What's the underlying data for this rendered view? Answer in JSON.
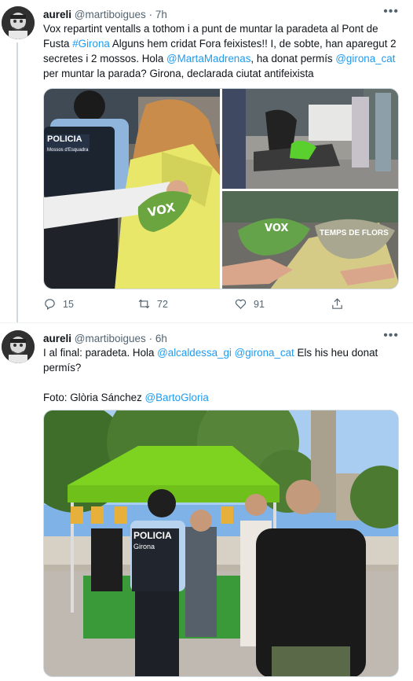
{
  "tweets": [
    {
      "name": "aureli",
      "handle": "@martiboigues",
      "time": "7h",
      "text_parts": [
        {
          "t": "Vox repartint ventalls a tothom i a punt de muntar la paradeta al Pont de Fusta ",
          "link": false
        },
        {
          "t": "#Girona",
          "link": true
        },
        {
          "t": " Alguns hem cridat Fora feixistes!! I, de sobte, han aparegut 2 secretes i 2 mossos. Hola ",
          "link": false
        },
        {
          "t": "@MartaMadrenas",
          "link": true
        },
        {
          "t": ", ha donat permís ",
          "link": false
        },
        {
          "t": "@girona_cat",
          "link": true
        },
        {
          "t": " per muntar la parada? Girona, declarada ciutat antifeixista",
          "link": false
        }
      ],
      "media_labels": {
        "police_patch": "POLICIA",
        "police_sub": "Mossos d'Esquadra",
        "fan_logo": "VOX",
        "fan_logo_2": "VOX",
        "fan_text": "TEMPS DE FLORS"
      },
      "reply_count": "15",
      "retweet_count": "72",
      "like_count": "91"
    },
    {
      "name": "aureli",
      "handle": "@martiboigues",
      "time": "6h",
      "text_parts": [
        {
          "t": "I al final: paradeta. Hola ",
          "link": false
        },
        {
          "t": "@alcaldessa_gi",
          "link": true
        },
        {
          "t": " ",
          "link": false
        },
        {
          "t": "@girona_cat",
          "link": true
        },
        {
          "t": " Els his heu donat permís?",
          "link": false
        },
        {
          "t": "\n\nFoto:  Glòria Sánchez ",
          "link": false
        },
        {
          "t": "@BartoGloria",
          "link": true
        }
      ],
      "media_labels": {
        "police_patch": "POLICIA",
        "police_sub": "Girona"
      }
    }
  ],
  "colors": {
    "link": "#1d9bf0",
    "muted": "#536471",
    "text": "#0f1419",
    "tent_green": "#7ed321"
  },
  "icons": {
    "reply": "reply-icon",
    "retweet": "retweet-icon",
    "like": "heart-icon",
    "share": "share-icon",
    "more": "more-icon"
  }
}
